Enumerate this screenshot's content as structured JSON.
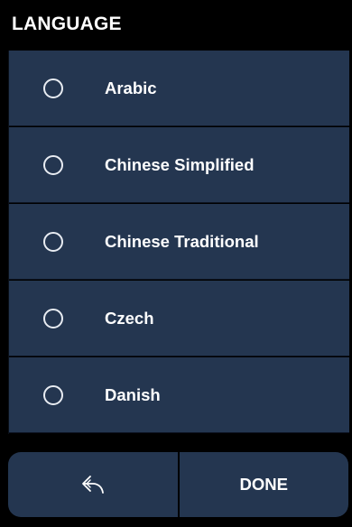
{
  "header": {
    "title": "LANGUAGE"
  },
  "languages": [
    {
      "label": "Arabic",
      "selected": false
    },
    {
      "label": "Chinese Simplified",
      "selected": false
    },
    {
      "label": "Chinese Traditional",
      "selected": false
    },
    {
      "label": "Czech",
      "selected": false
    },
    {
      "label": "Danish",
      "selected": false
    }
  ],
  "footer": {
    "back_icon": "back-arrow-icon",
    "done_label": "DONE"
  },
  "colors": {
    "background": "#000000",
    "panel": "#243650",
    "text": "#ffffff"
  }
}
